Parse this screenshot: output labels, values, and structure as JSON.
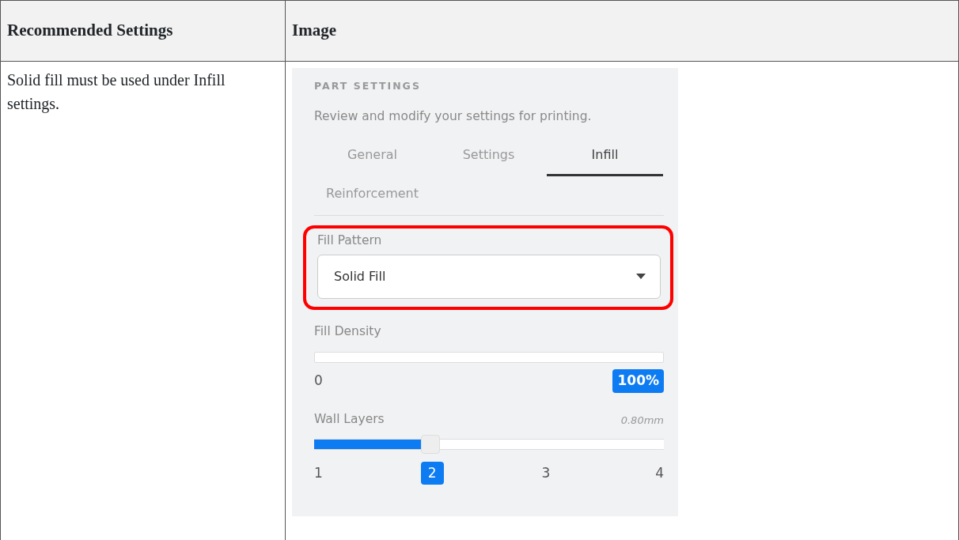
{
  "table": {
    "columns": [
      "Recommended Settings",
      "Image"
    ],
    "rows": [
      {
        "text": "Solid fill must be used under Infill settings.",
        "panel": {
          "heading": "PART SETTINGS",
          "subtitle": "Review and modify your settings for printing.",
          "tabs": [
            {
              "label": "General",
              "selected": false
            },
            {
              "label": "Settings",
              "selected": false
            },
            {
              "label": "Infill",
              "selected": true
            },
            {
              "label": "Reinforcement",
              "selected": false
            }
          ],
          "fill_pattern": {
            "label": "Fill Pattern",
            "value": "Solid Fill",
            "highlighted": true
          },
          "fill_density": {
            "label": "Fill Density",
            "min": "0",
            "value": "100%"
          },
          "wall_layers": {
            "label": "Wall Layers",
            "reading": "0.80mm",
            "level": 0.333,
            "ticks": [
              {
                "label": "1",
                "selected": false
              },
              {
                "label": "2",
                "selected": true
              },
              {
                "label": "3",
                "selected": false
              },
              {
                "label": "4",
                "selected": false
              }
            ]
          }
        }
      }
    ]
  }
}
